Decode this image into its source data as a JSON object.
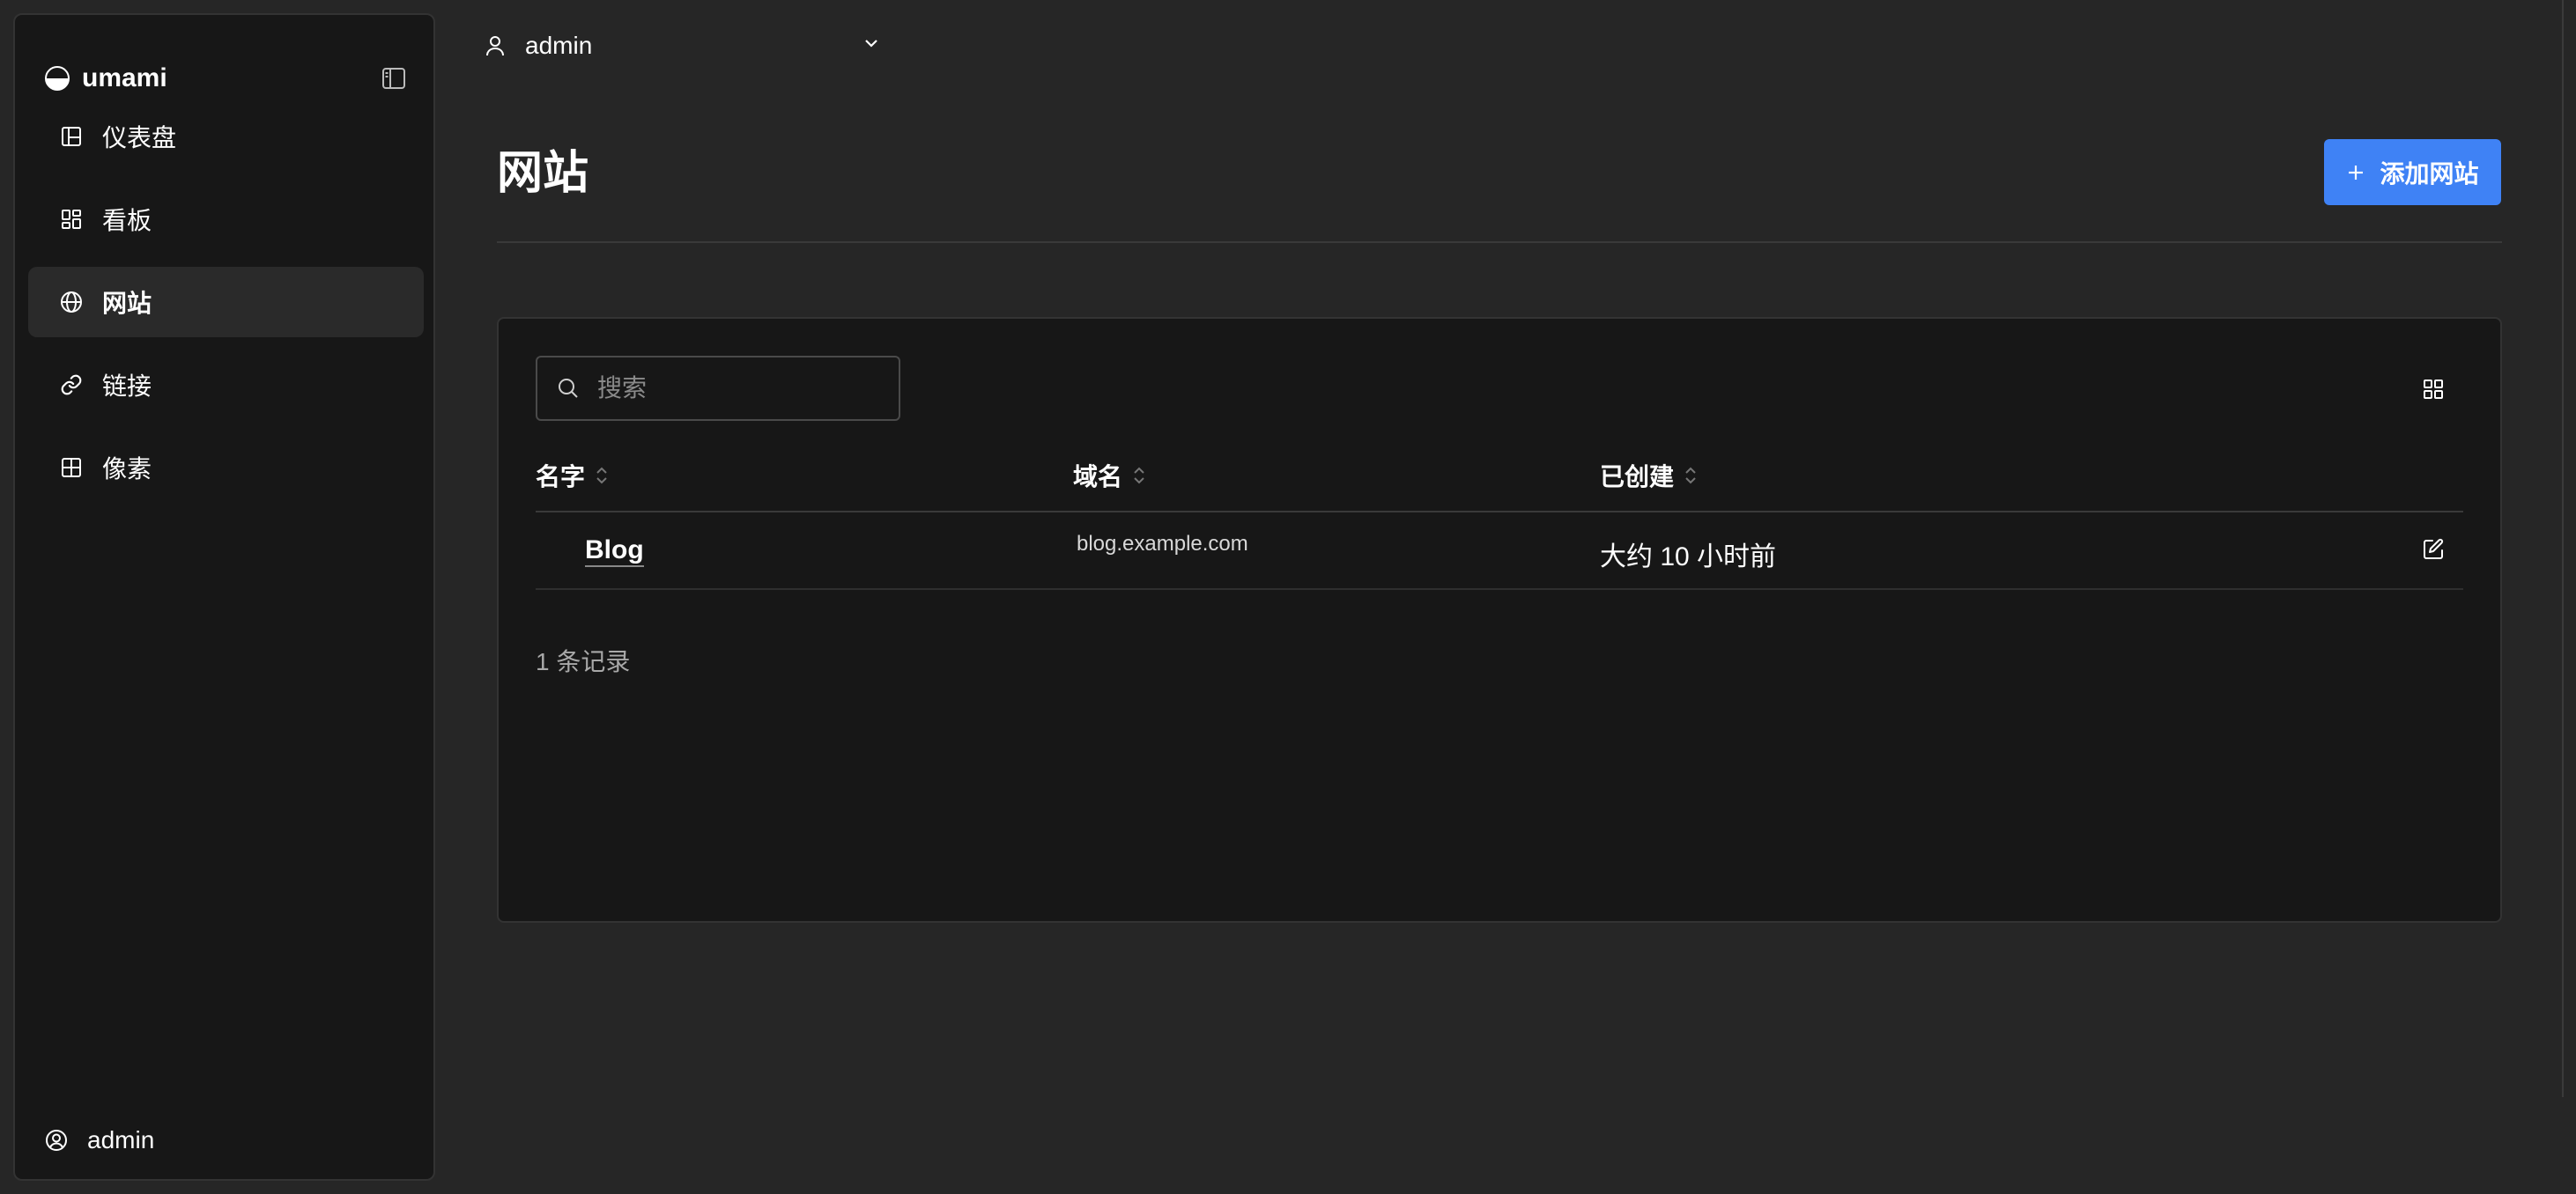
{
  "sidebar": {
    "brand": "umami",
    "items": [
      {
        "label": "仪表盘",
        "icon": "dashboard-icon"
      },
      {
        "label": "看板",
        "icon": "boards-icon"
      },
      {
        "label": "网站",
        "icon": "globe-icon"
      },
      {
        "label": "链接",
        "icon": "link-icon"
      },
      {
        "label": "像素",
        "icon": "pixel-grid-icon"
      }
    ],
    "active_item": "网站",
    "user": "admin"
  },
  "topbar": {
    "user": "admin"
  },
  "page": {
    "title": "网站",
    "add_button_label": "添加网站"
  },
  "search": {
    "placeholder": "搜索",
    "value": ""
  },
  "table": {
    "columns": [
      "名字",
      "域名",
      "已创建"
    ],
    "rows": [
      {
        "name": "Blog",
        "domain": "blog.example.com",
        "created": "大约 10 小时前"
      }
    ],
    "record_count": "1 条记录"
  },
  "colors": {
    "accent": "#3f82f5",
    "background": "#262626",
    "panel": "#171717"
  }
}
